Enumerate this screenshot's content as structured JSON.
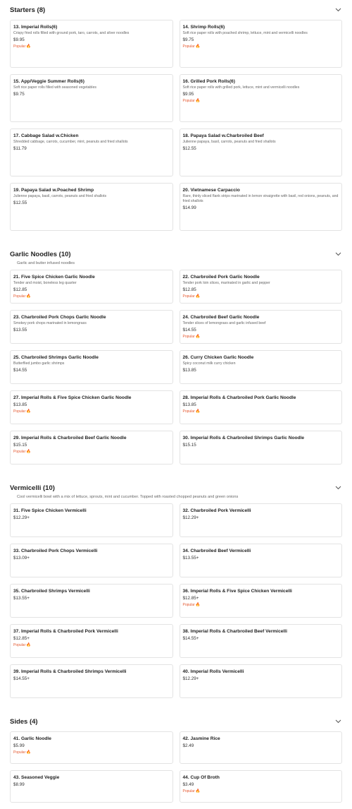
{
  "colors": {
    "popular": "#e4572e",
    "border": "#e3e3e3"
  },
  "icons": {
    "section_toggle": "chevron-down-icon",
    "popular": "flame-icon"
  },
  "popular_label": "Popular",
  "sections": [
    {
      "id": "starters",
      "title": "Starters (8)",
      "description": "",
      "card_height": 68,
      "items": [
        {
          "name": "13. Imperial Rolls(6)",
          "desc": "Crispy fried rolls filled with ground pork, taro, carrots, and silver noodles",
          "price": "$9.95",
          "popular": true
        },
        {
          "name": "14. Shrimp Rolls(6)",
          "desc": "Soft rice paper rolls with poached shrimp, lettuce, mint and vermicelli noodles",
          "price": "$9.75",
          "popular": true
        },
        {
          "name": "15. App/Veggie Summer Rolls(6)",
          "desc": "Soft rice paper rolls filled with seasoned vegetables",
          "price": "$9.75",
          "popular": false
        },
        {
          "name": "16. Grilled Pork Rolls(6)",
          "desc": "Soft rice paper rolls with grilled pork, lettuce, mint and vermicelli noodles",
          "price": "$9.95",
          "popular": true
        },
        {
          "name": "17. Cabbage Salad w.Chicken",
          "desc": "Shredded cabbage, carrots, cucumber, mint, peanuts and fried shallots",
          "price": "$11.79",
          "popular": false
        },
        {
          "name": "18. Papaya Salad w.Charbroiled Beef",
          "desc": "Julienne papaya, basil, carrots, peanuts and fried shallots",
          "price": "$12.55",
          "popular": false
        },
        {
          "name": "19. Papaya Salad w.Poached Shrimp",
          "desc": "Julienne papaya, basil, carrots, peanuts and fried shallots",
          "price": "$12.55",
          "popular": false
        },
        {
          "name": "20. Vietnamese Carpaccio",
          "desc": "Rare, thinly sliced flank strips marinated in lemon vinaigrette with basil, red onions, peanuts, and fried shallots",
          "price": "$14.99",
          "popular": false
        }
      ]
    },
    {
      "id": "garlic",
      "title": "Garlic Noodles (10)",
      "description": "Garlic and butter infused noodles",
      "card_height": 48,
      "items": [
        {
          "name": "21. Five Spice Chicken Garlic Noodle",
          "desc": "Tender and moist, boneless leg quarter",
          "price": "$12.85",
          "popular": true
        },
        {
          "name": "22. Charbroiled Pork Garlic Noodle",
          "desc": "Tender pork loin slices, marinated in garlic and pepper",
          "price": "$12.85",
          "popular": true
        },
        {
          "name": "23. Charbroiled Pork Chops Garlic Noodle",
          "desc": "Smokey pork chops marinated in lemongrass",
          "price": "$13.55",
          "popular": false
        },
        {
          "name": "24. Charbroiled Beef Garlic Noodle",
          "desc": "Tender slices of lemongrass and garlic infused beef",
          "price": "$14.55",
          "popular": true
        },
        {
          "name": "25. Charbroiled Shrimps Garlic Noodle",
          "desc": "Butterflied jumbo garlic shrimps",
          "price": "$14.55",
          "popular": false
        },
        {
          "name": "26. Curry Chicken Garlic Noodle",
          "desc": "Spicy coconut milk curry chicken",
          "price": "$13.85",
          "popular": false
        },
        {
          "name": "27. Imperial Rolls & Five Spice Chicken Garlic Noodle",
          "desc": "",
          "price": "$13.85",
          "popular": true
        },
        {
          "name": "28. Imperial Rolls & Charbroiled Pork Garlic Noodle",
          "desc": "",
          "price": "$13.85",
          "popular": true
        },
        {
          "name": "29. Imperial Rolls & Charbroiled Beef Garlic Noodle",
          "desc": "",
          "price": "$15.15",
          "popular": true
        },
        {
          "name": "30. Imperial Rolls & Charbroiled Shrimps Garlic Noodle",
          "desc": "",
          "price": "$15.15",
          "popular": false
        }
      ]
    },
    {
      "id": "vermicelli",
      "title": "Vermicelli (10)",
      "description": "Cool vermicelli bowl with a mix of lettuce, sprouts, mint and cucumber. Topped with roasted chopped peanuts and green onions",
      "card_height": 48,
      "items": [
        {
          "name": "31. Five Spice Chicken Vermicelli",
          "desc": "",
          "price": "$12.29+",
          "popular": false
        },
        {
          "name": "32. Charbroiled Pork Vermicelli",
          "desc": "",
          "price": "$12.29+",
          "popular": false
        },
        {
          "name": "33. Charbroiled Pork Chops Vermicelli",
          "desc": "",
          "price": "$13.09+",
          "popular": false
        },
        {
          "name": "34. Charbroiled Beef Vermicelli",
          "desc": "",
          "price": "$13.55+",
          "popular": false
        },
        {
          "name": "35. Charbroiled Shrimps Vermicelli",
          "desc": "",
          "price": "$13.55+",
          "popular": false
        },
        {
          "name": "36. Imperial Rolls & Five Spice Chicken Vermicelli",
          "desc": "",
          "price": "$12.85+",
          "popular": true
        },
        {
          "name": "37. Imperial Rolls & Charbroiled Pork Vermicelli",
          "desc": "",
          "price": "$12.85+",
          "popular": true
        },
        {
          "name": "38. Imperial Rolls & Charbroiled Beef Vermicelli",
          "desc": "",
          "price": "$14.55+",
          "popular": false
        },
        {
          "name": "39. Imperial Rolls & Charbroiled Shrimps Vermicelli",
          "desc": "",
          "price": "$14.55+",
          "popular": false
        },
        {
          "name": "40. Imperial Rolls Vermicelli",
          "desc": "",
          "price": "$12.29+",
          "popular": false
        }
      ]
    },
    {
      "id": "sides",
      "title": "Sides (4)",
      "description": "",
      "card_height": 46,
      "items": [
        {
          "name": "41. Garlic Noodle",
          "desc": "",
          "price": "$5.99",
          "popular": true
        },
        {
          "name": "42. Jasmine Rice",
          "desc": "",
          "price": "$2.49",
          "popular": false
        },
        {
          "name": "43. Seasoned Veggie",
          "desc": "",
          "price": "$8.99",
          "popular": false
        },
        {
          "name": "44. Cup Of Broth",
          "desc": "",
          "price": "$3.49",
          "popular": true
        }
      ]
    }
  ]
}
